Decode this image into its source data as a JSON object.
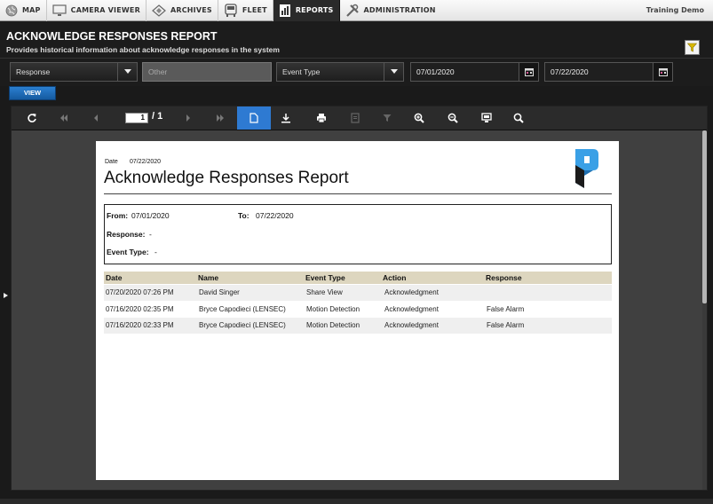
{
  "nav": {
    "items": [
      {
        "label": "MAP",
        "icon": "globe-icon"
      },
      {
        "label": "CAMERA VIEWER",
        "icon": "monitor-icon"
      },
      {
        "label": "ARCHIVES",
        "icon": "diamond-icon"
      },
      {
        "label": "FLEET",
        "icon": "bus-icon"
      },
      {
        "label": "REPORTS",
        "icon": "report-icon",
        "active": true
      },
      {
        "label": "ADMINISTRATION",
        "icon": "tools-icon"
      }
    ],
    "account": "Training Demo"
  },
  "header": {
    "title": "ACKNOWLEDGE RESPONSES REPORT",
    "subtitle": "Provides historical information about acknowledge responses in the system"
  },
  "filters": {
    "response_select": "Response",
    "other_placeholder": "Other",
    "event_type_select": "Event Type",
    "start_date": "07/01/2020",
    "end_date": "07/22/2020",
    "view_label": "VIEW"
  },
  "viewer": {
    "current_page": "1",
    "total_pages": "/ 1"
  },
  "report": {
    "date_label": "Date",
    "date_value": "07/22/2020",
    "title": "Acknowledge Responses Report",
    "from_label": "From:",
    "from_value": "07/01/2020",
    "to_label": "To:",
    "to_value": "07/22/2020",
    "response_label": "Response:",
    "response_value": "-",
    "event_type_label": "Event Type:",
    "event_type_value": "-",
    "columns": [
      "Date",
      "Name",
      "Event Type",
      "Action",
      "Response"
    ],
    "rows": [
      [
        "07/20/2020 07:26 PM",
        "David Singer",
        "Share View",
        "Acknowledgment",
        ""
      ],
      [
        "07/16/2020 02:35 PM",
        "Bryce Capodieci (LENSEC)",
        "Motion Detection",
        "Acknowledgment",
        "False Alarm"
      ],
      [
        "07/16/2020 02:33 PM",
        "Bryce Capodieci (LENSEC)",
        "Motion Detection",
        "Acknowledgment",
        "False Alarm"
      ]
    ]
  },
  "colors": {
    "accent": "#2e7ad2",
    "filter_icon": "#e0c400",
    "logo_blue": "#3aa0e6"
  }
}
